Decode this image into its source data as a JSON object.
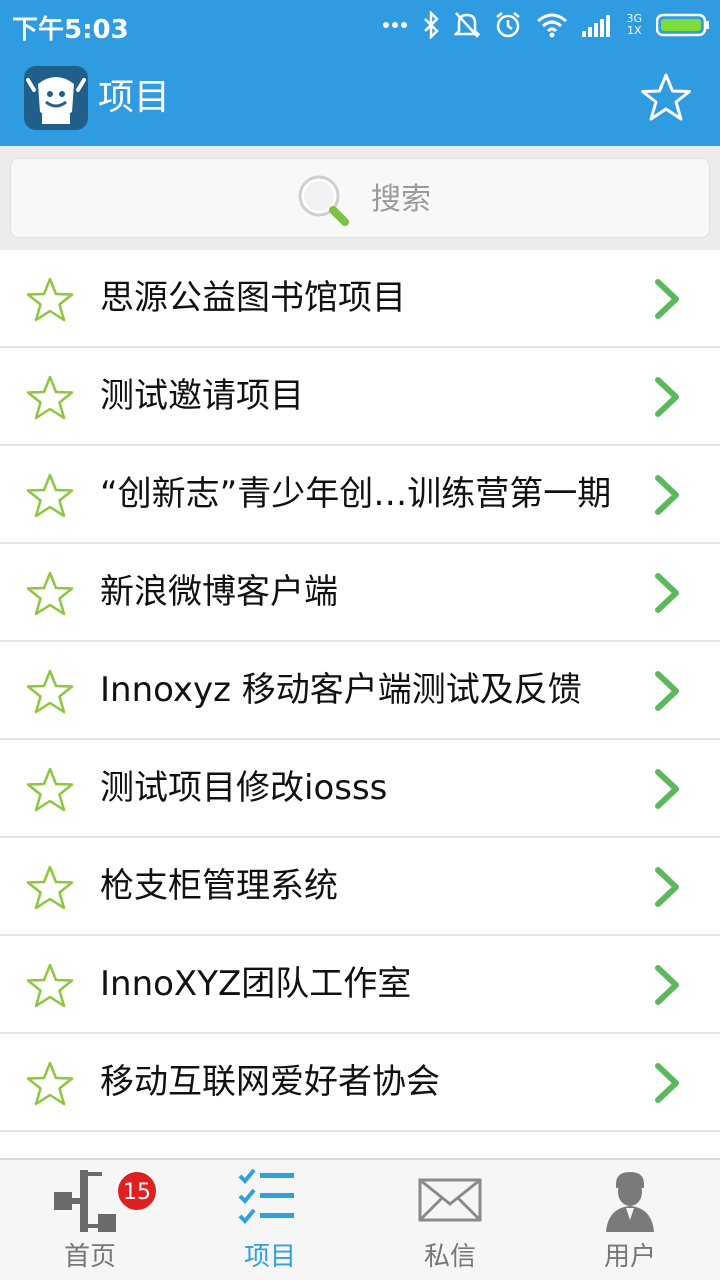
{
  "status_bar": {
    "time": "下午5:03",
    "network_top": "3G",
    "network_bottom": "1X"
  },
  "app_bar": {
    "title": "项目"
  },
  "search": {
    "placeholder": "搜索"
  },
  "projects": [
    {
      "name": "思源公益图书馆项目"
    },
    {
      "name": "测试邀请项目"
    },
    {
      "name": "“创新志”青少年创…训练营第一期"
    },
    {
      "name": "新浪微博客户端"
    },
    {
      "name": "Innoxyz 移动客户端测试及反馈"
    },
    {
      "name": "测试项目修改iosss"
    },
    {
      "name": "枪支柜管理系统"
    },
    {
      "name": "InnoXYZ团队工作室"
    },
    {
      "name": "移动互联网爱好者协会"
    }
  ],
  "tabs": [
    {
      "label": "首页",
      "badge": "15"
    },
    {
      "label": "项目"
    },
    {
      "label": "私信"
    },
    {
      "label": "用户"
    }
  ],
  "colors": {
    "primary": "#2f9be0",
    "active_tab": "#2ea2dd",
    "star_green": "#8dc63f",
    "chevron_green": "#5cb85c",
    "badge_red": "#e02020"
  }
}
